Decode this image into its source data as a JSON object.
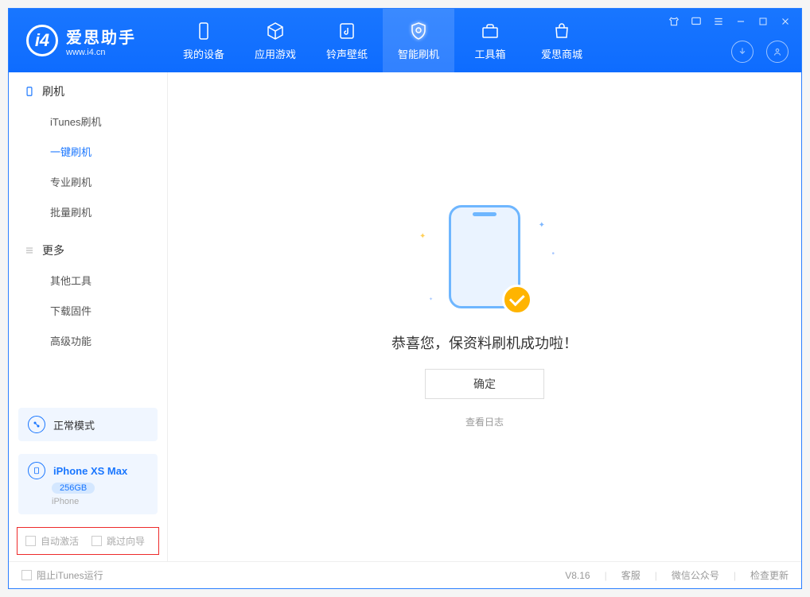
{
  "app": {
    "title": "爱思助手",
    "subtitle": "www.i4.cn"
  },
  "nav": {
    "items": [
      {
        "label": "我的设备",
        "icon": "device"
      },
      {
        "label": "应用游戏",
        "icon": "cube"
      },
      {
        "label": "铃声壁纸",
        "icon": "music"
      },
      {
        "label": "智能刷机",
        "icon": "shield",
        "active": true
      },
      {
        "label": "工具箱",
        "icon": "toolbox"
      },
      {
        "label": "爱思商城",
        "icon": "shop"
      }
    ]
  },
  "sidebar": {
    "section1_title": "刷机",
    "section1_items": [
      {
        "label": "iTunes刷机"
      },
      {
        "label": "一键刷机",
        "active": true
      },
      {
        "label": "专业刷机"
      },
      {
        "label": "批量刷机"
      }
    ],
    "section2_title": "更多",
    "section2_items": [
      {
        "label": "其他工具"
      },
      {
        "label": "下载固件"
      },
      {
        "label": "高级功能"
      }
    ],
    "mode_label": "正常模式",
    "device_name": "iPhone XS Max",
    "device_storage": "256GB",
    "device_type": "iPhone",
    "check1_label": "自动激活",
    "check2_label": "跳过向导"
  },
  "main": {
    "success_text": "恭喜您，保资料刷机成功啦！",
    "confirm_label": "确定",
    "log_link": "查看日志"
  },
  "footer": {
    "block_itunes": "阻止iTunes运行",
    "version": "V8.16",
    "link1": "客服",
    "link2": "微信公众号",
    "link3": "检查更新"
  }
}
